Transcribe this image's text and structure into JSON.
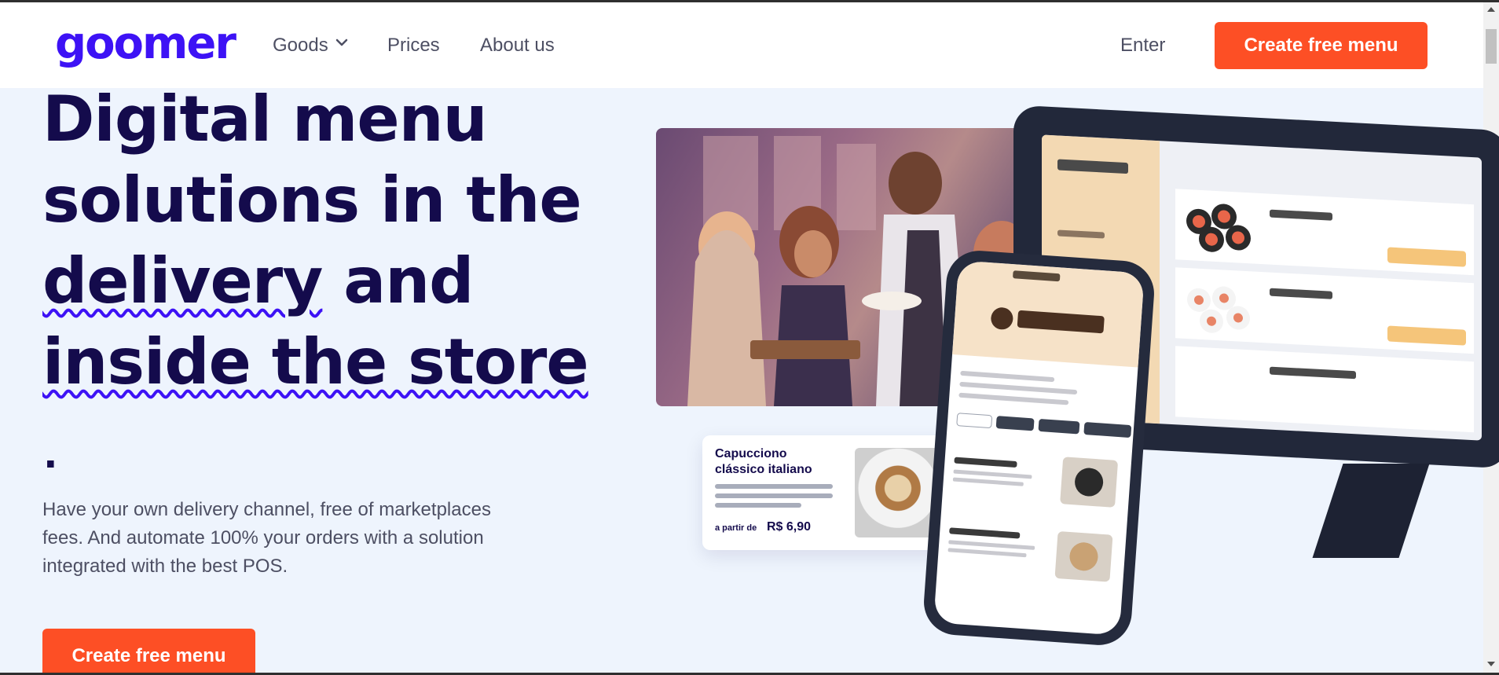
{
  "header": {
    "logo": "goomer",
    "nav": {
      "goods": "Goods",
      "prices": "Prices",
      "about": "About us"
    },
    "enter": "Enter",
    "cta": "Create free menu"
  },
  "hero": {
    "title_part1": "Digital menu solutions in the ",
    "title_underline1": "delivery",
    "title_part2": " and ",
    "title_underline2": "inside the store",
    "dot": ".",
    "subtitle": "Have your own delivery channel, free of marketplaces fees. And automate 100% your orders with a solution integrated with the best POS.",
    "cta": "Create free menu"
  },
  "card": {
    "title": "Capucciono clássico italiano",
    "price_prefix": "a partir de",
    "price": "R$ 6,90"
  },
  "colors": {
    "brand": "#3d12f5",
    "accent": "#fd4f25",
    "heading": "#140b4c",
    "background": "#eef4fd"
  }
}
